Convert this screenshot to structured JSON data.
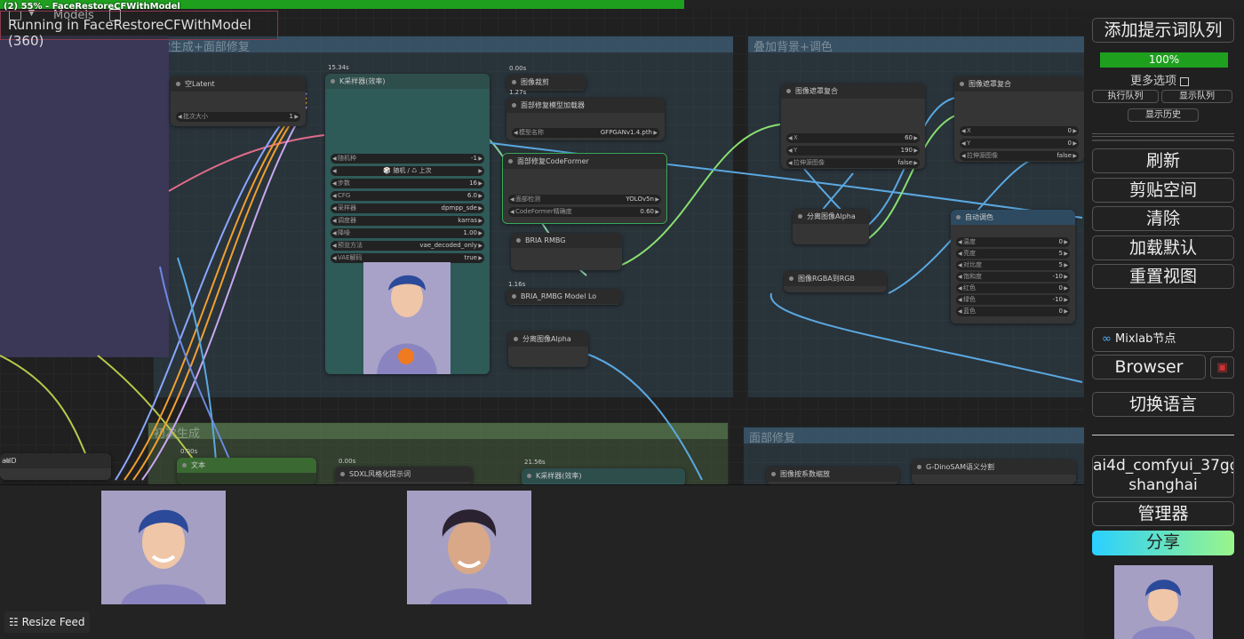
{
  "progress": {
    "percent": 55,
    "label": "(2) 55% - FaceRestoreCFWithModel"
  },
  "top_left": {
    "models_label": "Models"
  },
  "status": {
    "text": "Running in FaceRestoreCFWithModel (360)"
  },
  "groups": {
    "g1": "次生成+面部修复",
    "g2": "叠加背景+调色",
    "g3": "初次生成",
    "g4": "面部修复"
  },
  "nodes": {
    "empty_latent": {
      "title": "空Latent",
      "w_batch": "批次大小",
      "w_batch_val": "1"
    },
    "ksampler": {
      "time": "15.34s",
      "title": "K采样器(效率)",
      "seed": "随机种",
      "seed_val": "-1",
      "seed_btn": "🎲 随机 / ♺ 上次",
      "steps": "步数",
      "steps_val": "16",
      "cfg": "CFG",
      "cfg_val": "6.0",
      "sampler": "采样器",
      "sampler_val": "dpmpp_sde",
      "scheduler": "调度器",
      "scheduler_val": "karras",
      "denoise": "降噪",
      "denoise_val": "1.00",
      "preview": "预览方法",
      "preview_val": "vae_decoded_only",
      "vae": "VAE解码",
      "vae_val": "true"
    },
    "crop": {
      "time": "0.00s",
      "title": "图像裁剪"
    },
    "face_loader": {
      "time": "1.27s",
      "title": "面部修复模型加载器",
      "model": "模型名称",
      "model_val": "GFPGANv1.4.pth"
    },
    "codeformer": {
      "title": "面部修复CodeFormer",
      "detect": "面部检测",
      "detect_val": "YOLOv5n",
      "fidelity": "CodeFormer精确度",
      "fidelity_val": "0.60"
    },
    "bria": {
      "title": "BRIA RMBG"
    },
    "bria_loader": {
      "time": "1.16s",
      "title": "BRIA_RMBG Model Lo"
    },
    "split_alpha1": {
      "title": "分离图像Alpha"
    },
    "composite1": {
      "title": "图像遮罩复合",
      "x": "X",
      "x_val": "60",
      "y": "Y",
      "y_val": "190",
      "resize": "拉伸源图像",
      "resize_val": "false"
    },
    "composite2": {
      "title": "图像遮罩复合",
      "x": "X",
      "x_val": "0",
      "y": "Y",
      "y_val": "0",
      "resize": "拉伸源图像",
      "resize_val": "false"
    },
    "split_alpha2": {
      "title": "分离图像Alpha"
    },
    "rgba2rgb": {
      "title": "图像RGBA到RGB"
    },
    "auto_color": {
      "title": "自动调色",
      "r1": "温度",
      "r1v": "0",
      "r2": "亮度",
      "r2v": "5",
      "r3": "对比度",
      "r3v": "5",
      "r4": "饱和度",
      "r4v": "-10",
      "r5": "红色",
      "r5v": "0",
      "r6": "绿色",
      "r6v": "-10",
      "r7": "蓝色",
      "r7v": "0"
    },
    "text_node": {
      "time": "0.00s",
      "title": "文本"
    },
    "sdxl": {
      "time": "0.00s",
      "title": "SDXL风格化提示词"
    },
    "ksampler2": {
      "time": "21.56s",
      "title": "K采样器(效率)"
    },
    "scale": {
      "title": "图像按系数缩放"
    },
    "dino": {
      "title": "G-DinoSAM语义分割"
    },
    "partial_left": {
      "title": "atID"
    }
  },
  "right_panel": {
    "queue_prompt": "添加提示词队列",
    "progress_text": "100%",
    "more_options": "更多选项",
    "exec_queue": "执行队列",
    "show_queue": "显示队列",
    "show_history": "显示历史",
    "refresh": "刷新",
    "clipspace": "剪贴空间",
    "clear": "清除",
    "load_default": "加载默认",
    "reset_view": "重置视图",
    "mixlab": "Mixlab节点",
    "browser": "Browser",
    "switch_lang": "切换语言",
    "user_line1": "ai4d_comfyui_37gg",
    "user_line2": "shanghai",
    "manager": "管理器",
    "share": "分享"
  },
  "feed": {
    "resize_label": "Resize Feed"
  },
  "colors": {
    "progress": "#1ea01e",
    "share_from": "#2ad0ff",
    "share_to": "#9af58a",
    "portrait_bg": "#a59fc4"
  }
}
